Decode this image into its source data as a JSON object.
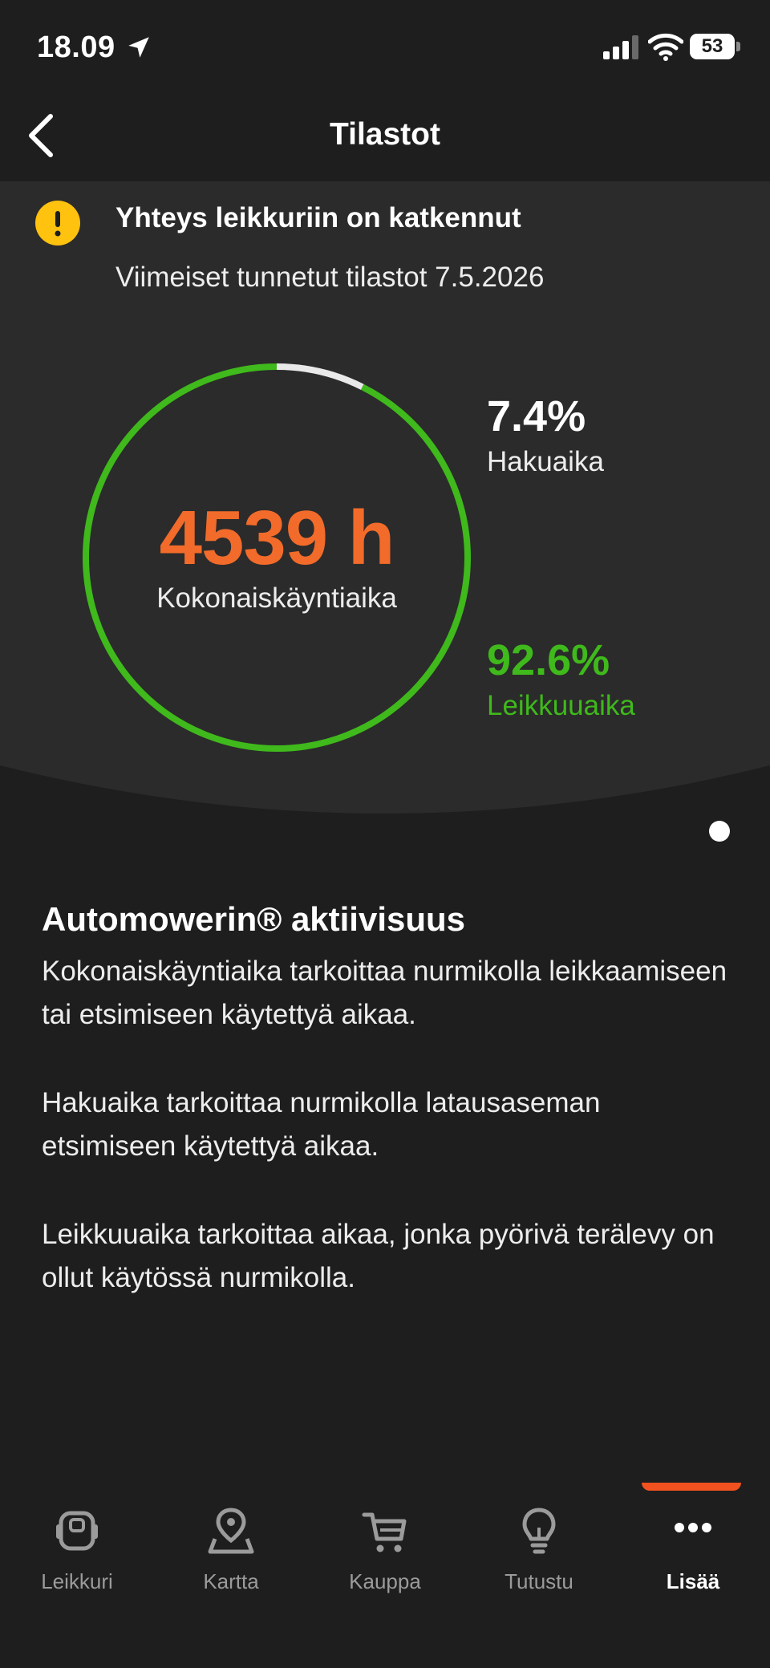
{
  "status_bar": {
    "time": "18.09",
    "battery": "53",
    "icons": [
      "location-arrow-icon",
      "signal-icon",
      "wifi-icon",
      "battery-icon"
    ]
  },
  "header": {
    "title": "Tilastot",
    "back_icon": "chevron-left-icon"
  },
  "alert": {
    "icon": "warning-icon",
    "title": "Yhteys leikkuriin on katkennut",
    "subtitle": "Viimeiset tunnetut tilastot 7.5.2026"
  },
  "stats": {
    "total_value": "4539 h",
    "total_label": "Kokonaiskäyntiaika",
    "search_percent": "7.4%",
    "search_label": "Hakuaika",
    "search_fraction": 0.074,
    "cut_percent": "92.6%",
    "cut_label": "Leikkuuaika",
    "cut_fraction": 0.926,
    "colors": {
      "cut": "#3fb91b",
      "search": "#e9e9e9",
      "total": "#f26b2a"
    }
  },
  "info": {
    "title": "Automowerin® aktiivisuus",
    "paragraphs": [
      "Kokonaiskäyntiaika tarkoittaa nurmikolla leikkaamiseen tai etsimiseen käytettyä aikaa.",
      "Hakuaika tarkoittaa nurmikolla latausaseman etsimiseen käytettyä aikaa.",
      "Leikkuuaika tarkoittaa aikaa, jonka pyörivä terälevy on ollut käytössä nurmikolla."
    ]
  },
  "tabs": [
    {
      "label": "Leikkuri",
      "icon": "mower-icon",
      "active": false
    },
    {
      "label": "Kartta",
      "icon": "map-pin-icon",
      "active": false
    },
    {
      "label": "Kauppa",
      "icon": "cart-icon",
      "active": false
    },
    {
      "label": "Tutustu",
      "icon": "lightbulb-icon",
      "active": false
    },
    {
      "label": "Lisää",
      "icon": "more-icon",
      "active": true
    }
  ],
  "accent_color": "#f2521f"
}
